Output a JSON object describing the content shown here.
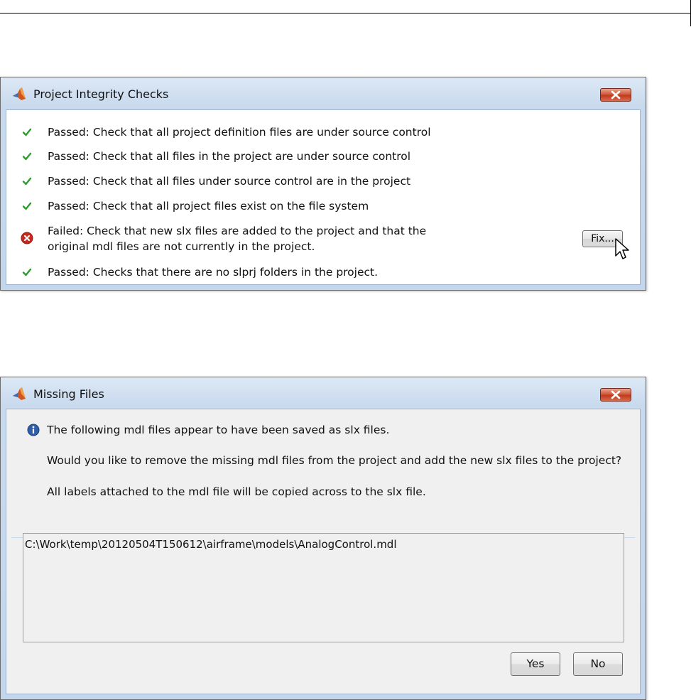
{
  "integrity_dialog": {
    "title": "Project Integrity Checks",
    "close_icon": "close-icon",
    "checks": [
      {
        "status": "passed",
        "icon": "check-icon",
        "line1": "Passed: Check that all project definition files are under source control",
        "line2": ""
      },
      {
        "status": "passed",
        "icon": "check-icon",
        "line1": "Passed: Check that all files in the project are under source control",
        "line2": ""
      },
      {
        "status": "passed",
        "icon": "check-icon",
        "line1": "Passed: Check that all files under source control are in the project",
        "line2": ""
      },
      {
        "status": "passed",
        "icon": "check-icon",
        "line1": "Passed: Check that all project files exist on the file system",
        "line2": ""
      },
      {
        "status": "failed",
        "icon": "error-icon",
        "line1": "Failed: Check that new slx files are added to the project and that the",
        "line2": "original mdl files are not currently in the project."
      },
      {
        "status": "passed",
        "icon": "check-icon",
        "line1": "Passed: Checks that there are no slprj folders in the project.",
        "line2": ""
      }
    ],
    "fix_label": "Fix..."
  },
  "missing_dialog": {
    "title": "Missing Files",
    "info_icon": "info-icon",
    "line1": "The following mdl files appear to have been saved as slx files.",
    "line2": "Would you like to remove the missing mdl files from the project and add the new slx files to the project?",
    "line3": "All labels attached to the mdl file will be copied across to the slx file.",
    "files": [
      "C:\\Work\\temp\\20120504T150612\\airframe\\models\\AnalogControl.mdl"
    ],
    "yes_label": "Yes",
    "no_label": "No"
  },
  "colors": {
    "pass": "#2e9c2e",
    "fail": "#c8281e",
    "info": "#2f5fa8",
    "close": "#c03a1e"
  }
}
